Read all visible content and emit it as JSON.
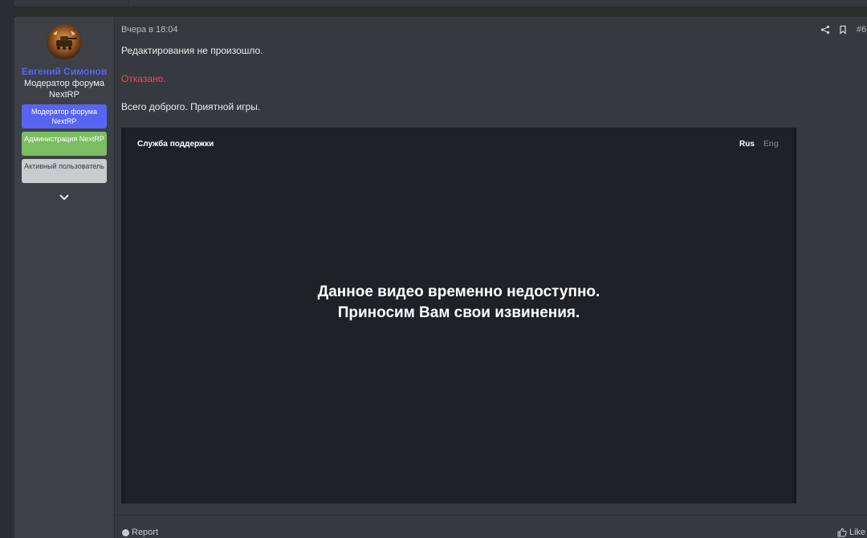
{
  "post": {
    "author": {
      "name": "Евгений Симонов",
      "title": "Модератор форума NextRP",
      "banners": [
        {
          "label": "Модератор форума NextRP",
          "color": "#5865f2"
        },
        {
          "label": "Администрация NextRP",
          "color": "#7cbd63"
        },
        {
          "label": "Активный пользователь",
          "color": "#c9cbcf"
        }
      ]
    },
    "date": "Вчера в 18:04",
    "number": "#6",
    "lines": [
      "Редактирования не произошло.",
      "Отказано.",
      "Всего доброго. Приятной игры."
    ],
    "video": {
      "brand": "Служба поддержки",
      "lang_active": "Rus",
      "lang_inactive": "Eng",
      "message": "Данное видео временно недоступно. Приносим Вам свои извинения."
    },
    "actions": {
      "report": "Report",
      "like": "Like"
    }
  },
  "icons": {
    "share": "share-icon",
    "bookmark": "bookmark-icon",
    "expand": "chevron-down-icon",
    "report": "info-icon",
    "like": "thumbs-up-icon"
  },
  "colors": {
    "username": "#5865f2",
    "refused": "#e05252",
    "background": "#36393f"
  }
}
